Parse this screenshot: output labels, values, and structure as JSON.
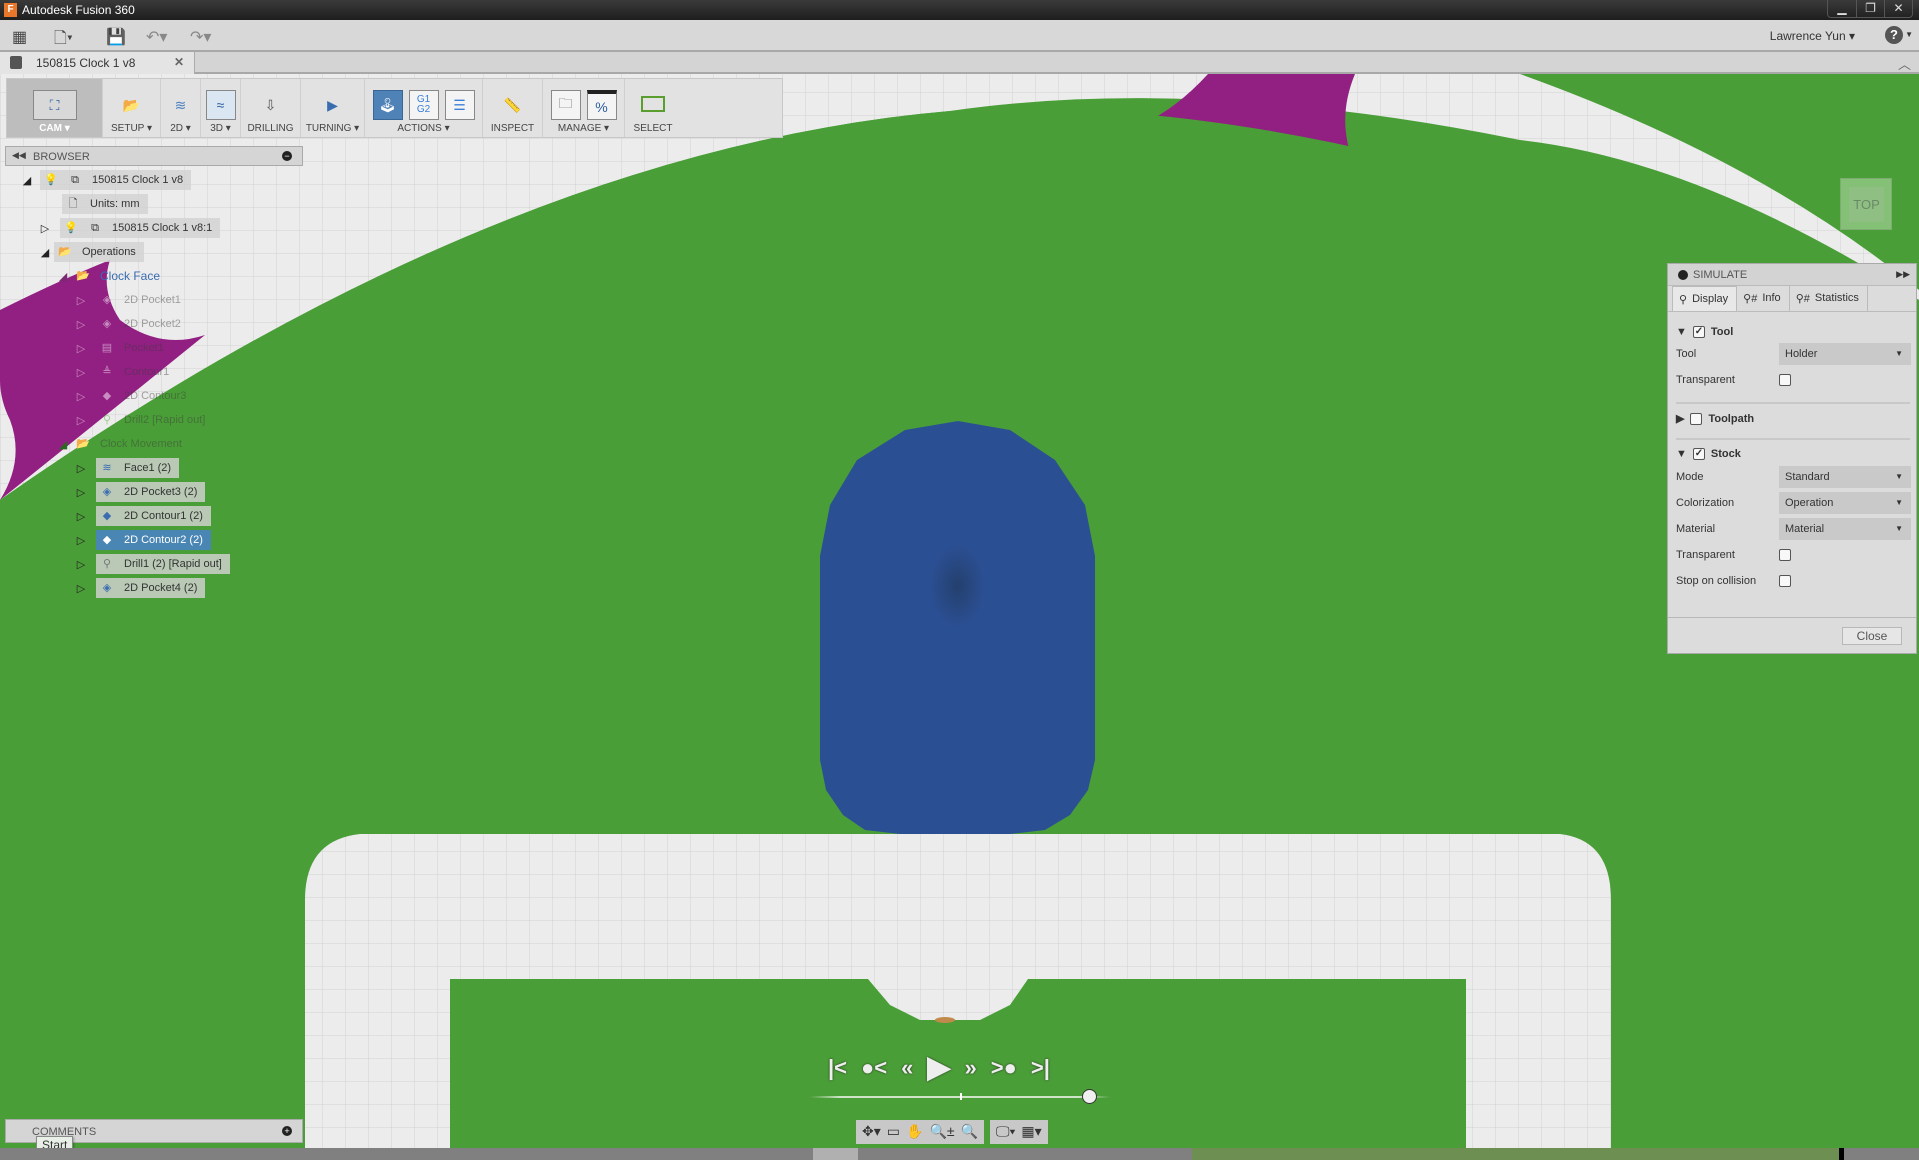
{
  "window": {
    "title": "Autodesk Fusion 360",
    "controls": [
      "minimize",
      "restore",
      "close"
    ]
  },
  "qat": {
    "user": "Lawrence Yun",
    "help": "?"
  },
  "tab": {
    "label": "150815 Clock 1 v8"
  },
  "toolbar": {
    "groups": [
      {
        "label": "CAM ▾"
      },
      {
        "label": "SETUP ▾"
      },
      {
        "label": "2D ▾"
      },
      {
        "label": "3D ▾"
      },
      {
        "label": "DRILLING"
      },
      {
        "label": "TURNING ▾"
      },
      {
        "label": "ACTIONS ▾"
      },
      {
        "label": "INSPECT"
      },
      {
        "label": "MANAGE ▾"
      },
      {
        "label": "SELECT"
      }
    ],
    "g1g2": "G1\nG2",
    "percent": "%"
  },
  "browser": {
    "title": "BROWSER",
    "nodes": [
      {
        "label": "150815 Clock 1 v8"
      },
      {
        "label": "Units: mm"
      },
      {
        "label": "150815 Clock 1 v8:1"
      },
      {
        "label": "Operations"
      },
      {
        "label": "Clock Face"
      },
      {
        "label": "2D Pocket1"
      },
      {
        "label": "2D Pocket2"
      },
      {
        "label": "Pocket1"
      },
      {
        "label": "Contour1"
      },
      {
        "label": "2D Contour3"
      },
      {
        "label": "Drill2 [Rapid out]"
      },
      {
        "label": "Clock Movement"
      },
      {
        "label": "Face1 (2)"
      },
      {
        "label": "2D Pocket3 (2)"
      },
      {
        "label": "2D Contour1 (2)"
      },
      {
        "label": "2D Contour2 (2)",
        "selected": true
      },
      {
        "label": "Drill1 (2) [Rapid out]"
      },
      {
        "label": "2D Pocket4 (2)"
      }
    ]
  },
  "simulate": {
    "title": "SIMULATE",
    "tabs": [
      "Display",
      "Info",
      "Statistics"
    ],
    "active_tab": "Display",
    "tool_section": {
      "label": "Tool",
      "checked": true,
      "tool_label": "Tool",
      "tool_value": "Holder",
      "transparent_label": "Transparent",
      "transparent": false
    },
    "toolpath_section": {
      "label": "Toolpath",
      "checked": false
    },
    "stock_section": {
      "label": "Stock",
      "checked": true,
      "mode_label": "Mode",
      "mode_value": "Standard",
      "colorization_label": "Colorization",
      "colorization_value": "Operation",
      "material_label": "Material",
      "material_value": "Material",
      "transparent_label": "Transparent",
      "transparent": false,
      "stop_label": "Stop on collision",
      "stop": false
    },
    "close_label": "Close"
  },
  "viewcube": {
    "label": "TOP"
  },
  "playback": {
    "position_fraction": 0.93
  },
  "comments": {
    "title": "COMMENTS"
  },
  "tooltip": {
    "text": "Start"
  },
  "colors": {
    "stock_green": "#4a9e37",
    "tool_blue": "#2b4f93",
    "magenta": "#921f82",
    "selected_row": "#4a86b3"
  }
}
